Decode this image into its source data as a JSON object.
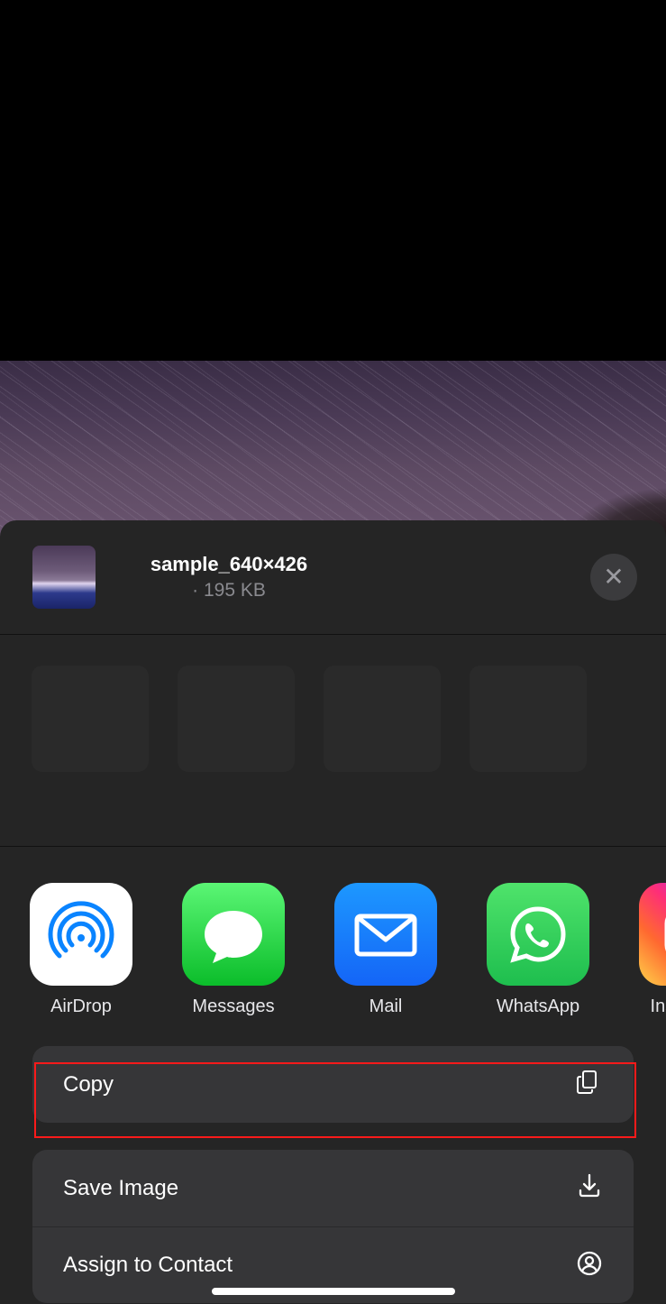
{
  "file": {
    "name": "sample_640×426",
    "size_label": " · 195 KB"
  },
  "apps": {
    "airdrop": "AirDrop",
    "messages": "Messages",
    "mail": "Mail",
    "whatsapp": "WhatsApp",
    "instagram": "Instagram"
  },
  "actions": {
    "copy": "Copy",
    "save_image": "Save Image",
    "assign_contact": "Assign to Contact"
  },
  "icons": {
    "close": "✕"
  }
}
